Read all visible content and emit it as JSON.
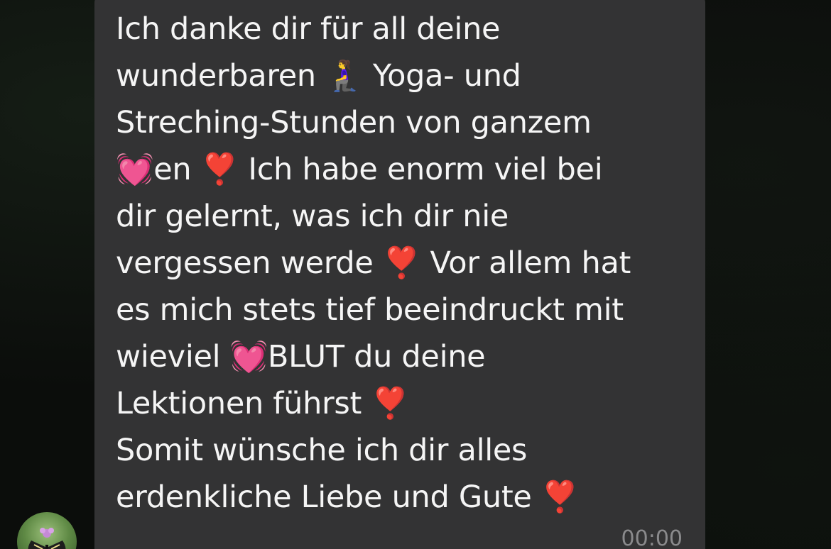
{
  "message": {
    "lines": [
      "Ich danke dir für all deine",
      "wunderbaren 🧎‍♀️ Yoga- und",
      "Streching-Stunden von ganzem",
      "💓en ❣️ Ich habe enorm viel bei",
      "dir gelernt, was ich dir nie",
      "vergessen werde ❣️  Vor allem hat",
      "es mich stets tief beeindruckt mit",
      "wieviel 💓BLUT du deine",
      "Lektionen führst ❣️",
      "Somit wünsche ich dir alles",
      "erdenkliche Liebe und Gute ❣️"
    ],
    "timestamp": "00:00"
  },
  "avatar": {
    "icon": "butterfly-icon"
  },
  "colors": {
    "bubble": "#333334",
    "text": "#f5f5f5",
    "timestamp": "#8a8a8c"
  }
}
